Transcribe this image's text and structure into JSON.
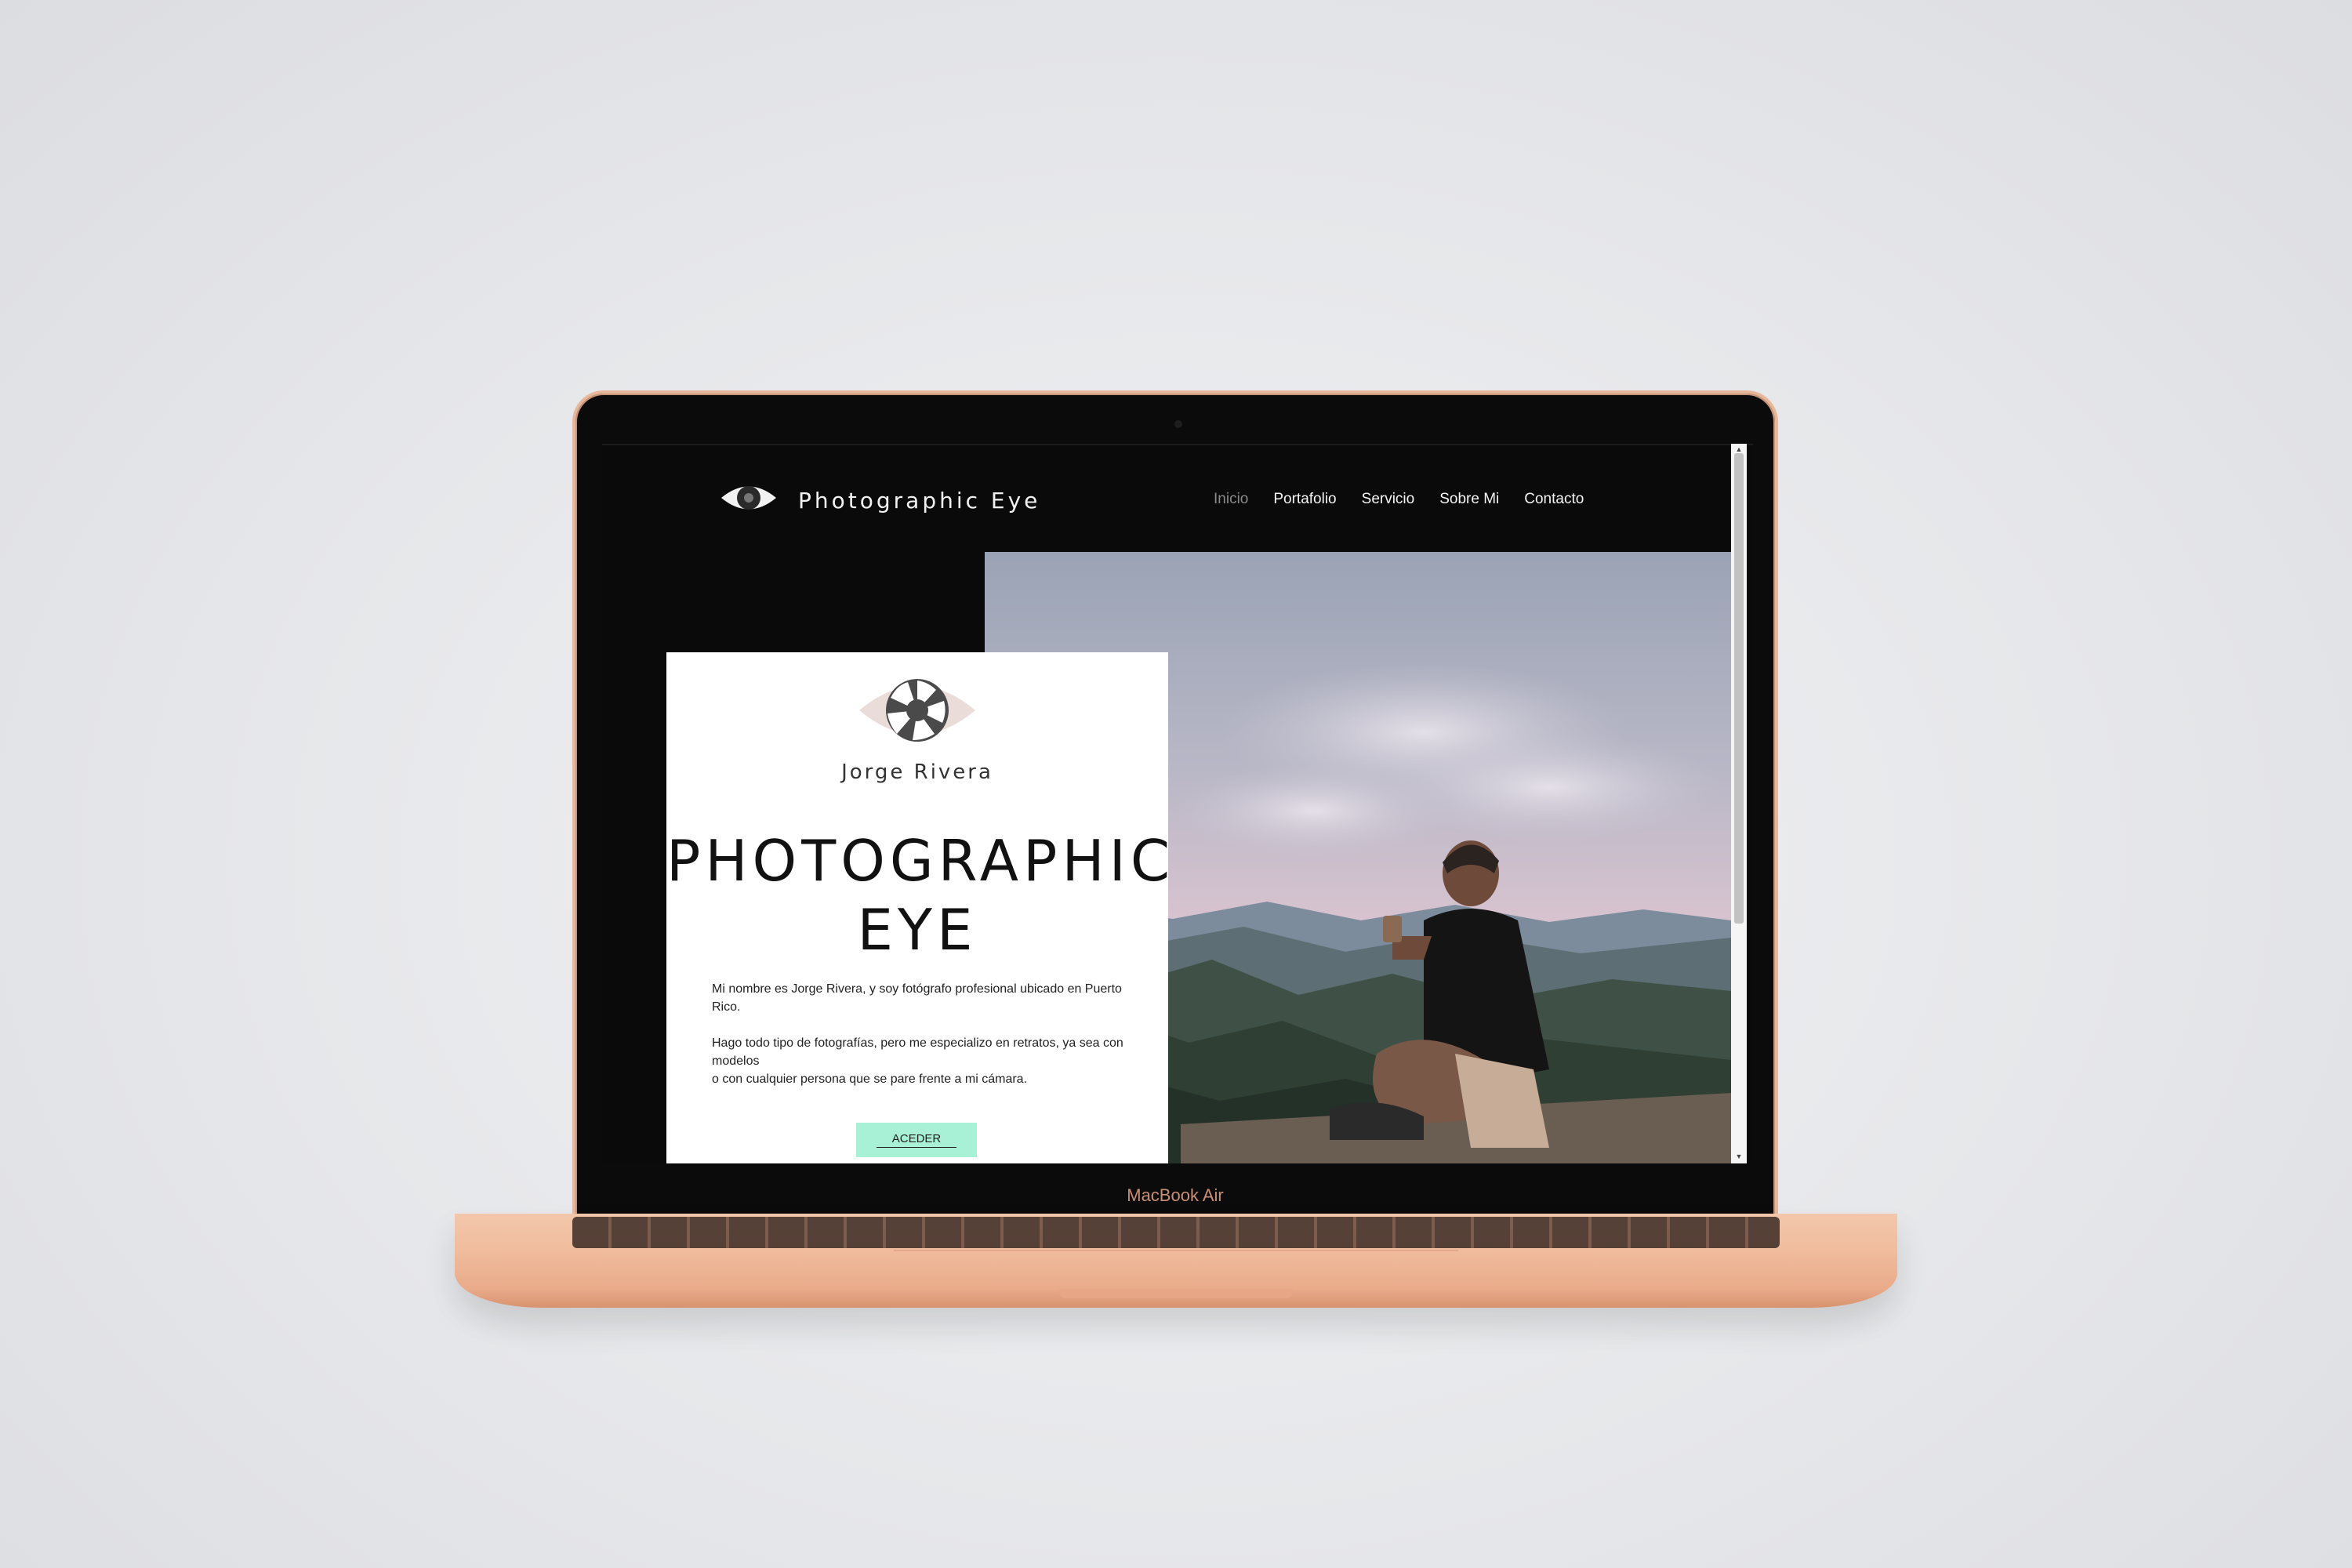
{
  "device": {
    "label": "MacBook Air"
  },
  "site": {
    "title": "Photographic Eye",
    "nav": [
      {
        "label": "Inicio",
        "active": true
      },
      {
        "label": "Portafolio",
        "active": false
      },
      {
        "label": "Servicio",
        "active": false
      },
      {
        "label": "Sobre Mi",
        "active": false
      },
      {
        "label": "Contacto",
        "active": false
      }
    ]
  },
  "hero": {
    "name": "Jorge Rivera",
    "title_line1": "PHOTOGRAPHIC",
    "title_line2": "EYE",
    "paragraph1": "Mi nombre es Jorge Rivera, y soy fotógrafo profesional ubicado en Puerto Rico.",
    "paragraph2_line1": "Hago todo tipo de fotografías, pero me especializo en retratos, ya sea con modelos",
    "paragraph2_line2": "o con cualquier persona que se pare frente a mi cámara.",
    "cta_label": "ACEDER"
  },
  "colors": {
    "accent": "#a8f0d6",
    "background": "#0a0a0a",
    "laptop": "#f0bc9d"
  }
}
